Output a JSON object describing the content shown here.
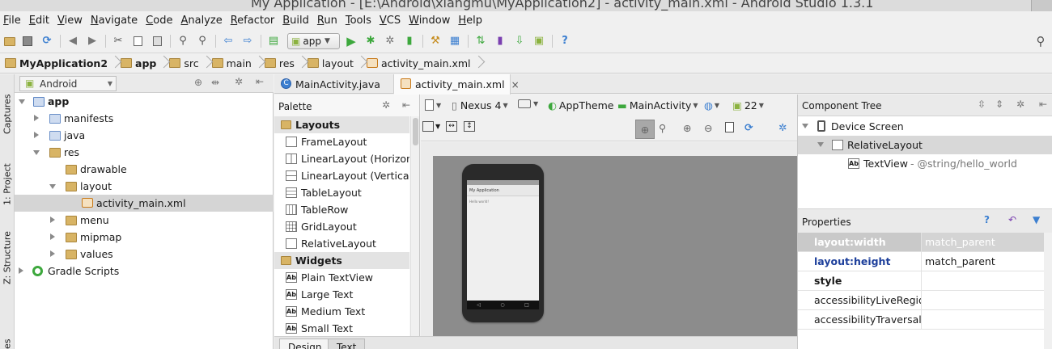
{
  "window": {
    "title": "My Application - [E:\\Android\\xiangmu\\MyApplication2] - activity_main.xml - Android Studio 1.3.1"
  },
  "menu": [
    "File",
    "Edit",
    "View",
    "Navigate",
    "Code",
    "Analyze",
    "Refactor",
    "Build",
    "Run",
    "Tools",
    "VCS",
    "Window",
    "Help"
  ],
  "toolbar": {
    "run_config": "app",
    "help": "?"
  },
  "breadcrumbs": [
    "MyApplication2",
    "app",
    "src",
    "main",
    "res",
    "layout",
    "activity_main.xml"
  ],
  "side_tabs": [
    "Captures",
    "1: Project",
    "Z: Structure",
    "es"
  ],
  "project": {
    "view_mode": "Android",
    "tree": [
      {
        "label": "app",
        "bold": true,
        "expanded": true
      },
      {
        "label": "manifests",
        "expanded": false
      },
      {
        "label": "java",
        "expanded": false
      },
      {
        "label": "res",
        "expanded": true
      },
      {
        "label": "drawable"
      },
      {
        "label": "layout",
        "expanded": true
      },
      {
        "label": "activity_main.xml",
        "selected": true
      },
      {
        "label": "menu",
        "expanded": false
      },
      {
        "label": "mipmap",
        "expanded": false
      },
      {
        "label": "values",
        "expanded": false
      },
      {
        "label": "Gradle Scripts",
        "expanded": false
      }
    ]
  },
  "editor_tabs": [
    {
      "label": "MainActivity.java",
      "active": false
    },
    {
      "label": "activity_main.xml",
      "active": true,
      "close": "×"
    }
  ],
  "palette": {
    "title": "Palette",
    "groups": [
      {
        "name": "Layouts",
        "items": [
          "FrameLayout",
          "LinearLayout (Horizontal)",
          "LinearLayout (Vertical)",
          "TableLayout",
          "TableRow",
          "GridLayout",
          "RelativeLayout"
        ]
      },
      {
        "name": "Widgets",
        "items": [
          "Plain TextView",
          "Large Text",
          "Medium Text",
          "Small Text"
        ]
      }
    ],
    "text_item_icon": "Ab"
  },
  "design_toolbar": {
    "device": "Nexus 4",
    "theme": "AppTheme",
    "activity": "MainActivity",
    "api": "22"
  },
  "preview": {
    "app_title": "My Application",
    "text": "Hello world!",
    "nav_glyphs": [
      "◁",
      "○",
      "□"
    ]
  },
  "bottom_tabs": [
    "Design",
    "Text"
  ],
  "component_tree": {
    "title": "Component Tree",
    "nodes": [
      {
        "label": "Device Screen"
      },
      {
        "label": "RelativeLayout",
        "selected": true
      },
      {
        "label": "TextView",
        "detail": "- @string/hello_world",
        "icon": "Ab"
      }
    ]
  },
  "properties": {
    "title": "Properties",
    "rows": [
      {
        "key": "layout:width",
        "value": "match_parent",
        "selected": true
      },
      {
        "key": "layout:height",
        "value": "match_parent",
        "emphasis": "blue"
      },
      {
        "key": "style",
        "value": "",
        "emphasis": "bold"
      },
      {
        "key": "accessibilityLiveRegion",
        "value": ""
      },
      {
        "key": "accessibilityTraversalAfter",
        "value": ""
      }
    ]
  },
  "colors": {
    "folder": "#d8b465",
    "android_green": "#8bb23f",
    "run_green": "#3da83d",
    "selection": "#d5d5d5",
    "blue_text": "#1d3f9b"
  }
}
